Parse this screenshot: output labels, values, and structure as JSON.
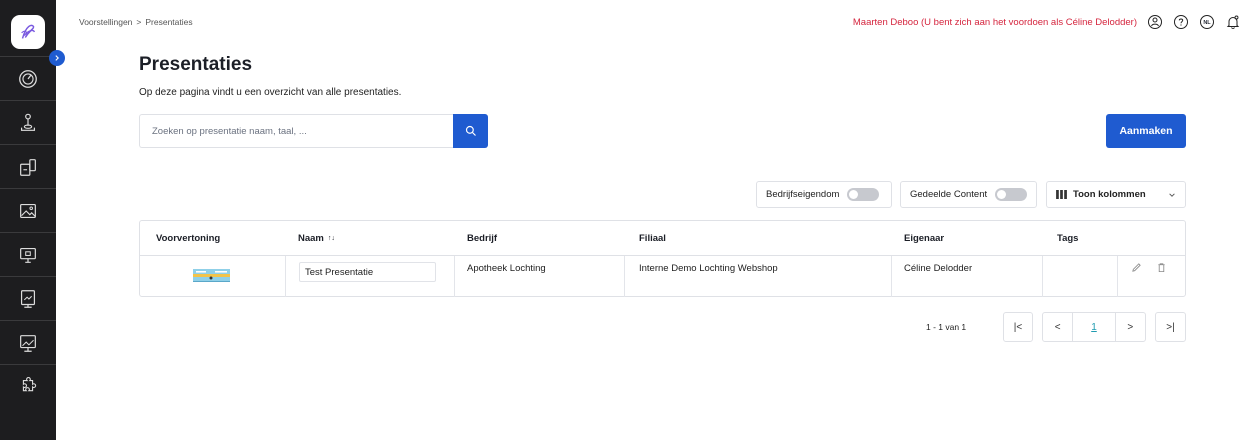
{
  "breadcrumb": {
    "items": [
      "Voorstellingen",
      "Presentaties"
    ],
    "separator": ">"
  },
  "header": {
    "user_notice": "Maarten Deboo (U bent zich aan het voordoen als Céline Delodder)",
    "language": "NL"
  },
  "page": {
    "title": "Presentaties",
    "description": "Op deze pagina vindt u een overzicht van alle presentaties."
  },
  "search": {
    "placeholder": "Zoeken op presentatie naam, taal, ..."
  },
  "actions": {
    "create_label": "Aanmaken"
  },
  "filters": {
    "company_owned": {
      "label": "Bedrijfseigendom",
      "on": false
    },
    "shared_content": {
      "label": "Gedeelde Content",
      "on": false
    },
    "columns_label": "Toon kolommen"
  },
  "table": {
    "headers": [
      "Voorvertoning",
      "Naam",
      "Bedrijf",
      "Filiaal",
      "Eigenaar",
      "Tags"
    ],
    "sort_indicator": "↑↓",
    "rows": [
      {
        "name": "Test Presentatie",
        "company": "Apotheek Lochting",
        "branch": "Interne Demo Lochting Webshop",
        "owner": "Céline Delodder",
        "tags": ""
      }
    ]
  },
  "pagination": {
    "summary": "1 - 1 van 1",
    "current_page": "1",
    "first": "|<",
    "prev": "<",
    "next": ">",
    "last": ">|"
  },
  "colors": {
    "accent": "#1f5bd0",
    "notice": "#d5253e",
    "sidebar": "#1d1d1f"
  },
  "sidebar_icons": [
    "logo-icon",
    "dashboard-icon",
    "joystick-icon",
    "devices-icon",
    "image-icon",
    "monitor-icon",
    "display-icon",
    "presentation-icon",
    "puzzle-icon"
  ]
}
